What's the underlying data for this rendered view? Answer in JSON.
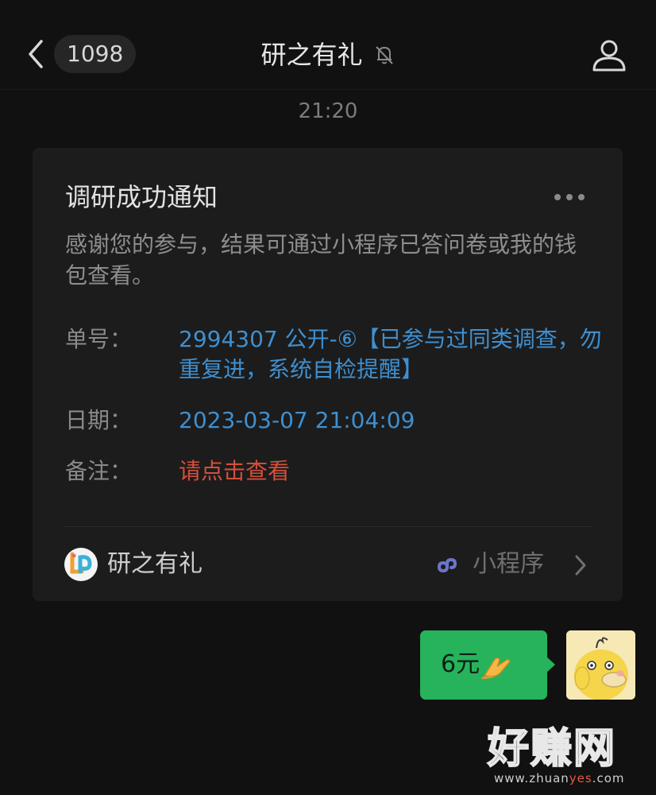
{
  "header": {
    "unread_count": "1098",
    "title": "研之有礼"
  },
  "timestamp": "21:20",
  "card": {
    "title": "调研成功通知",
    "description": "感谢您的参与，结果可通过小程序已答问卷或我的钱包查看。",
    "fields": [
      {
        "label": "单号：",
        "value": "2994307 公开-⑥【已参与过同类调查，勿重复进，系统自检提醒】"
      },
      {
        "label": "日期：",
        "value": "2023-03-07 21:04:09"
      },
      {
        "label": "备注：",
        "value": "请点击查看"
      }
    ],
    "footer": {
      "name": "研之有礼",
      "type_label": "小程序"
    }
  },
  "message": {
    "text": "6元",
    "emoji": "folded-hands-emoji"
  },
  "watermark": {
    "big": "好赚网",
    "small_a": "www.zhuan",
    "small_b": "yes",
    "small_c": ".com"
  },
  "colors": {
    "background": "#111111",
    "card": "#1c1c1c",
    "link_blue": "#3f8fcf",
    "alert_red": "#d2503b",
    "bubble_green": "#26b35c"
  }
}
